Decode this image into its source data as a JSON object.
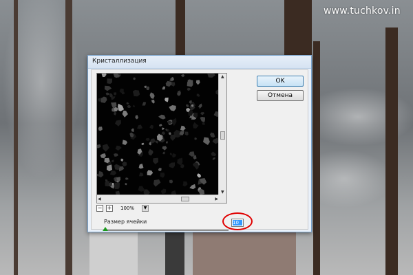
{
  "watermark": "www.tuchkov.in",
  "dialog": {
    "title": "Кристаллизация",
    "zoom": "100%",
    "zoom_out_symbol": "−",
    "zoom_in_symbol": "+",
    "ok_label": "OK",
    "cancel_label": "Отмена",
    "cell_size_label": "Размер ячейки",
    "cell_size_value": "10"
  },
  "colors": {
    "annotation": "#e00000",
    "slider_thumb": "#1c9a1c",
    "field_highlight": "#3399ff"
  },
  "icons": {
    "zoom_out": "minus-icon",
    "zoom_in": "plus-icon",
    "zoom_menu": "triangle-down-icon",
    "scroll": "scroll-arrow-icon"
  }
}
